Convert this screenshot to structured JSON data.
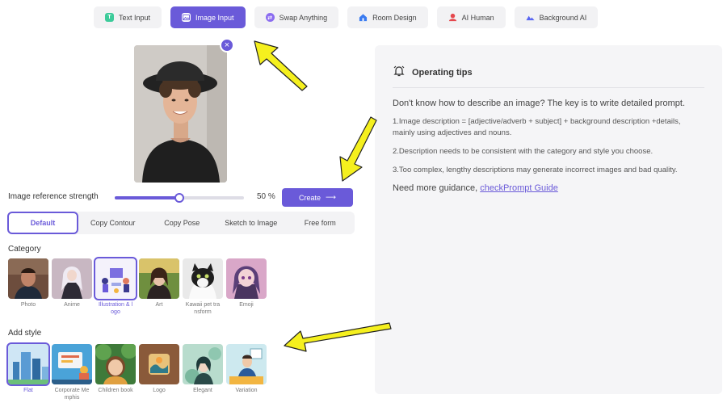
{
  "tabs": [
    {
      "label": "Text Input",
      "icon": "text-icon",
      "color": "#3ccb9a",
      "active": false
    },
    {
      "label": "Image Input",
      "icon": "image-icon",
      "color": "#ffffff",
      "active": true
    },
    {
      "label": "Swap Anything",
      "icon": "swap-icon",
      "color": "#8b6cf0",
      "active": false
    },
    {
      "label": "Room Design",
      "icon": "house-icon",
      "color": "#3a7bf0",
      "active": false
    },
    {
      "label": "AI Human",
      "icon": "person-icon",
      "color": "#e5484d",
      "active": false
    },
    {
      "label": "Background AI",
      "icon": "landscape-icon",
      "color": "#5865f2",
      "active": false
    }
  ],
  "strength": {
    "label": "Image reference strength",
    "value_text": "50 %",
    "value": 0.5
  },
  "create_label": "Create",
  "modes": [
    "Default",
    "Copy Contour",
    "Copy Pose",
    "Sketch to Image",
    "Free form"
  ],
  "category": {
    "title": "Category",
    "items": [
      {
        "label": "Photo",
        "selected": false
      },
      {
        "label": "Anime",
        "selected": false
      },
      {
        "label": "Illustration & l ogo",
        "selected": true
      },
      {
        "label": "Art",
        "selected": false
      },
      {
        "label": "Kawaii pet tra nsform",
        "selected": false
      },
      {
        "label": "Emoji",
        "selected": false
      }
    ]
  },
  "style": {
    "title": "Add style",
    "items": [
      {
        "label": "Flat",
        "selected": true
      },
      {
        "label": "Corporate Me mphis",
        "selected": false
      },
      {
        "label": "Children book",
        "selected": false
      },
      {
        "label": "Logo",
        "selected": false
      },
      {
        "label": "Elegant",
        "selected": false
      },
      {
        "label": "Variation",
        "selected": false
      }
    ]
  },
  "tips": {
    "title": "Operating tips",
    "intro": "Don't know how to describe an image? The key is to write detailed prompt.",
    "items": [
      "1.Image description = [adjective/adverb + subject] + background description +details, mainly using adjectives and nouns.",
      "2.Description needs to be consistent with the category and style you choose.",
      "3.Too complex, lengthy descriptions may generate incorrect images and bad quality."
    ],
    "guide_prefix": "Need more guidance, ",
    "guide_link": "checkPrompt Guide"
  },
  "accent_color": "#6a5ad9",
  "arrow_color": "#f5f01e"
}
